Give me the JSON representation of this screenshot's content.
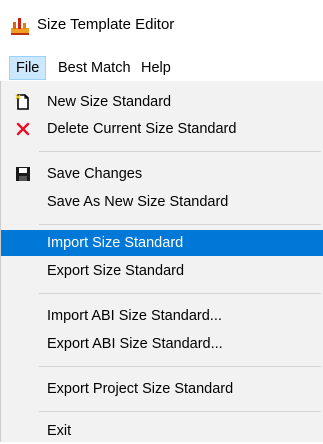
{
  "window": {
    "title": "Size Template Editor",
    "icon": "size-template-app-icon"
  },
  "menubar": {
    "items": [
      {
        "label": "File"
      },
      {
        "label": "Best Match"
      },
      {
        "label": "Help"
      }
    ]
  },
  "file_menu": {
    "new": {
      "label": "New  Size Standard",
      "icon": "new-document-icon"
    },
    "delete": {
      "label": "Delete Current Size Standard",
      "icon": "delete-x-icon"
    },
    "save": {
      "label": "Save Changes",
      "icon": "floppy-disk-icon"
    },
    "save_as": {
      "label": "Save As New Size Standard"
    },
    "import": {
      "label": "Import Size Standard"
    },
    "export": {
      "label": "Export Size Standard"
    },
    "import_abi": {
      "label": "Import ABI Size Standard..."
    },
    "export_abi": {
      "label": "Export ABI Size Standard..."
    },
    "export_project": {
      "label": "Export Project Size Standard"
    },
    "exit": {
      "label": "Exit"
    }
  },
  "colors": {
    "highlight": "#0078d7",
    "menu_bg": "#f2f2f2",
    "active_menu_bg": "#cce8ff",
    "delete_red": "#e81123"
  }
}
